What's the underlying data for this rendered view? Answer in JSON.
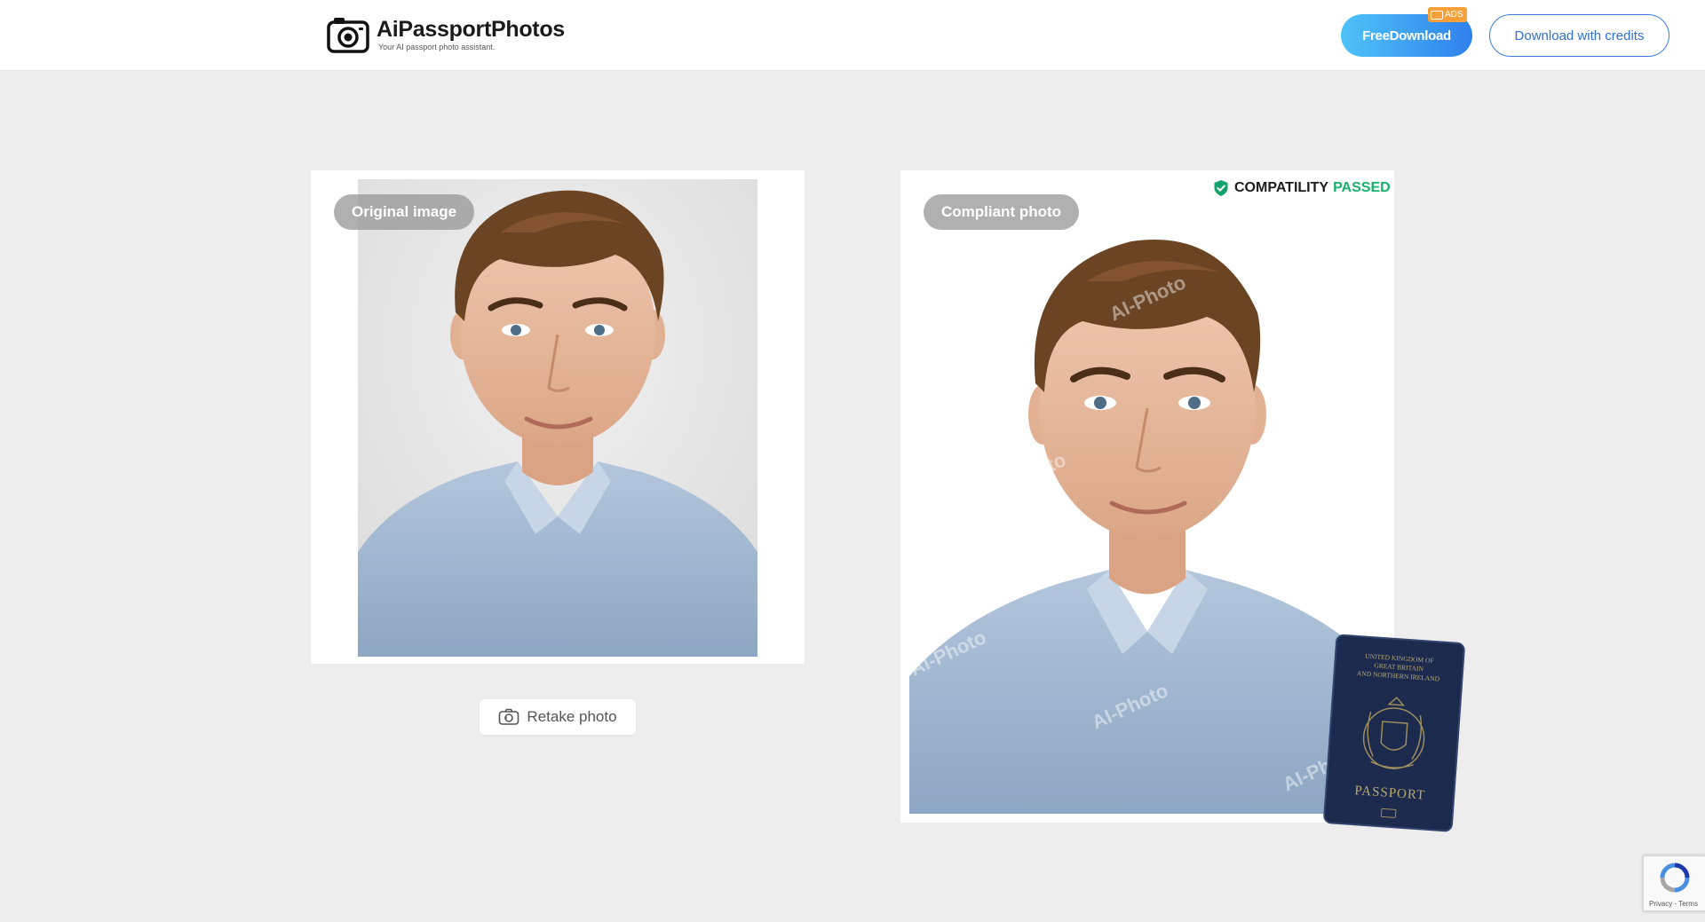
{
  "header": {
    "logo_title": "AiPassportPhotos",
    "logo_subtitle": "Your AI passport photo assistant.",
    "free_download_label": "FreeDownload",
    "ads_badge": "ADS",
    "download_credits_label": "Download with credits"
  },
  "original": {
    "label": "Original image",
    "retake_label": "Retake photo"
  },
  "compliant": {
    "label": "Compliant photo",
    "status_word": "COMPATILITY",
    "status_result": "PASSED",
    "watermark": "AI-Photo"
  },
  "passport": {
    "line1": "UNITED KINGDOM OF",
    "line2": "GREAT BRITAIN",
    "line3": "AND NORTHERN IRELAND",
    "title": "PASSPORT"
  },
  "recaptcha": {
    "links": "Privacy - Terms"
  },
  "colors": {
    "accent": "#2f80ed",
    "pass_green": "#17b26a",
    "background": "#ededed",
    "ads": "#f6a03a"
  }
}
